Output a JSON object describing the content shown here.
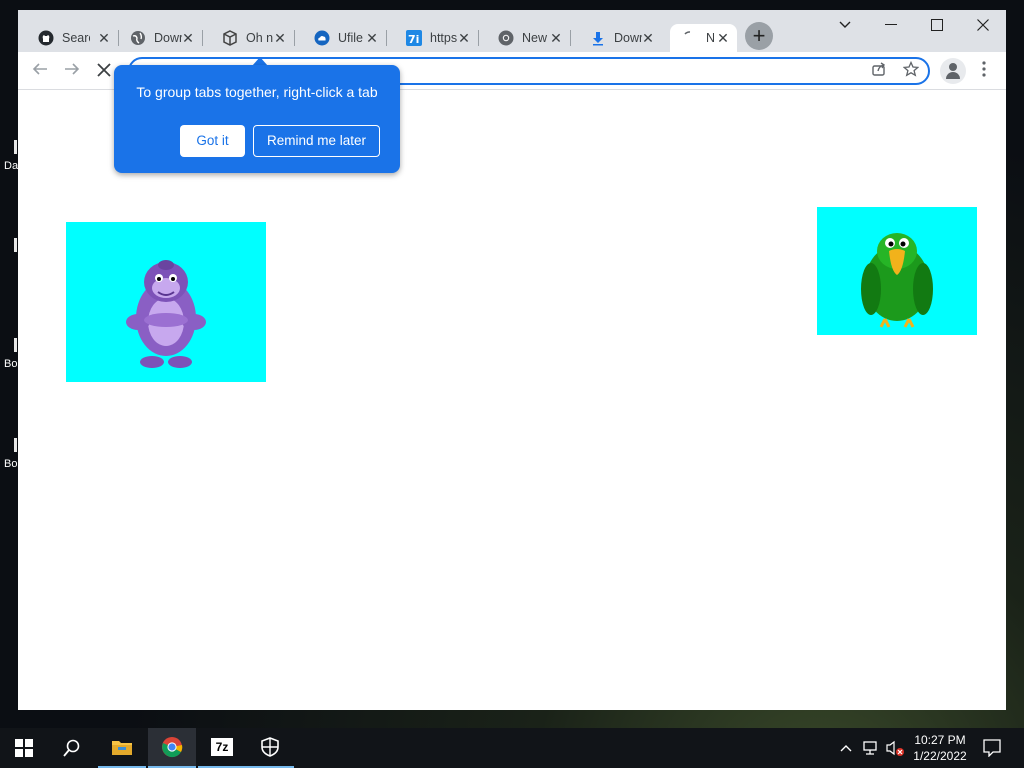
{
  "desktop": {
    "icons": [
      {
        "label": "Da"
      },
      {
        "label": ""
      },
      {
        "label": "Bo"
      },
      {
        "label": "Bo"
      }
    ]
  },
  "browser": {
    "tabs": [
      {
        "title": "Searc",
        "icon": "github-icon"
      },
      {
        "title": "Dowr",
        "icon": "globe-icon"
      },
      {
        "title": "Oh n",
        "icon": "package-icon"
      },
      {
        "title": "Ufile",
        "icon": "cloud-icon"
      },
      {
        "title": "https",
        "icon": "7i-icon"
      },
      {
        "title": "New",
        "icon": "chrome-icon"
      },
      {
        "title": "Dowr",
        "icon": "download-icon"
      },
      {
        "title": "N",
        "icon": "loading-icon"
      }
    ],
    "new_tab_label": "+",
    "window_controls": {
      "minimize": "—",
      "maximize": "☐",
      "close": "✕"
    },
    "address": "",
    "callout": {
      "message": "To group tabs together, right-click a tab",
      "got_it": "Got it",
      "remind_later": "Remind me later"
    },
    "accent": "#1a73e8"
  },
  "page": {
    "images": [
      {
        "name": "purple-gorilla-image",
        "background": "#00ffff"
      },
      {
        "name": "green-parrot-image",
        "background": "#00ffff"
      }
    ]
  },
  "taskbar": {
    "apps": [
      "start-icon",
      "search-icon",
      "file-explorer-icon",
      "chrome-icon",
      "7zip-icon",
      "security-icon"
    ],
    "app_7zip_label": "7z",
    "time": "10:27 PM",
    "date": "1/22/2022"
  }
}
